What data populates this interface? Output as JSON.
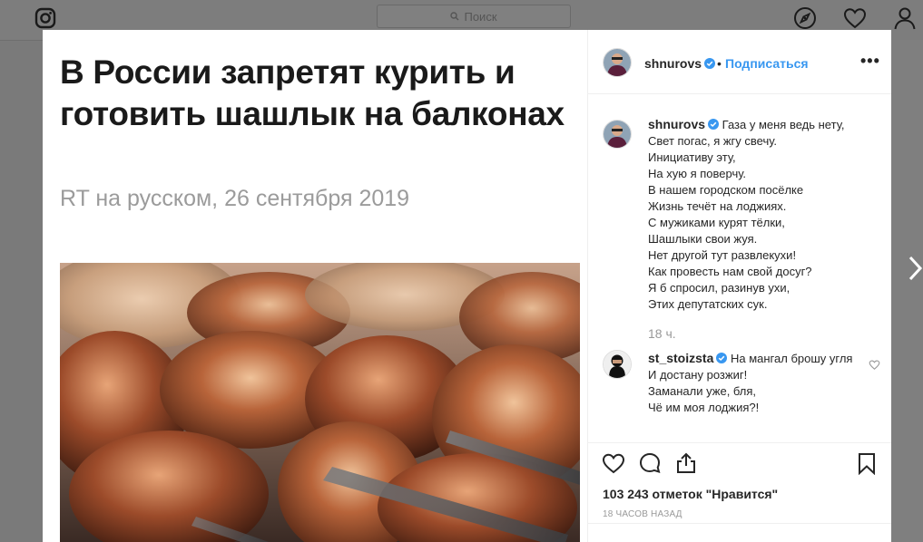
{
  "topbar": {
    "search_placeholder": "Поиск",
    "icons": [
      "instagram-logo-icon",
      "compass-icon",
      "heart-icon",
      "profile-icon"
    ]
  },
  "post": {
    "headline": "В России запретят курить и готовить шашлык на балконах",
    "source": "RT на русском, 26 сентября 2019"
  },
  "header": {
    "username": "shnurovs",
    "separator": "•",
    "follow_label": "Подписаться",
    "more_label": "•••"
  },
  "caption": {
    "username": "shnurovs",
    "lines": [
      "Газа у меня ведь нету,",
      "Свет погас, я жгу свечу.",
      "Инициативу эту,",
      "На хую я поверчу.",
      "В нашем городском посёлке",
      "Жизнь течёт на лоджиях.",
      "С мужиками курят тёлки,",
      "Шашлыки свои жуя.",
      "Нет другой тут развлекухи!",
      "Как провесть нам свой досуг?",
      "Я б спросил, разинув ухи,",
      "Этих депутатских сук."
    ],
    "time": "18 ч."
  },
  "comment": {
    "username": "st_stoizsta",
    "first_text": "На мангал брошу угля",
    "lines": [
      "И достану розжиг!",
      "Заманали уже, бля,",
      "Чё им моя лоджия?!"
    ]
  },
  "actions": {
    "likes": "103 243 отметок \"Нравится\"",
    "time": "18 ЧАСОВ НАЗАД"
  },
  "colors": {
    "accent": "#3897f0",
    "verified": "#3897f0",
    "text": "#262626",
    "muted": "#999999"
  }
}
